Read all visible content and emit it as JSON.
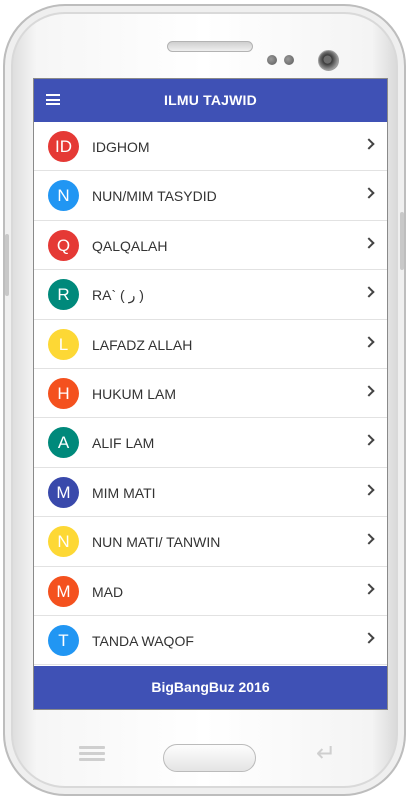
{
  "app": {
    "title": "ILMU TAJWID",
    "footer": "BigBangBuz 2016"
  },
  "items": [
    {
      "badge": "ID",
      "label": "IDGHOM",
      "color": "#e53935"
    },
    {
      "badge": "N",
      "label": "NUN/MIM TASYDID",
      "color": "#2196f3"
    },
    {
      "badge": "Q",
      "label": "QALQALAH",
      "color": "#e53935"
    },
    {
      "badge": "R",
      "label": "RA` ( ر )",
      "color": "#00897b"
    },
    {
      "badge": "L",
      "label": "LAFADZ ALLAH",
      "color": "#fdd835"
    },
    {
      "badge": "H",
      "label": "HUKUM LAM",
      "color": "#f4511e"
    },
    {
      "badge": "A",
      "label": "ALIF LAM",
      "color": "#00897b"
    },
    {
      "badge": "M",
      "label": "MIM MATI",
      "color": "#3949ab"
    },
    {
      "badge": "N",
      "label": "NUN MATI/ TANWIN",
      "color": "#fdd835"
    },
    {
      "badge": "M",
      "label": "MAD",
      "color": "#f4511e"
    },
    {
      "badge": "T",
      "label": "TANDA WAQOF",
      "color": "#2196f3"
    }
  ],
  "icons": {
    "menu": "hamburger-menu-icon",
    "chevron": "chevron-right-icon",
    "back": "back-arrow-icon"
  },
  "colors": {
    "primary": "#3f51b5"
  }
}
